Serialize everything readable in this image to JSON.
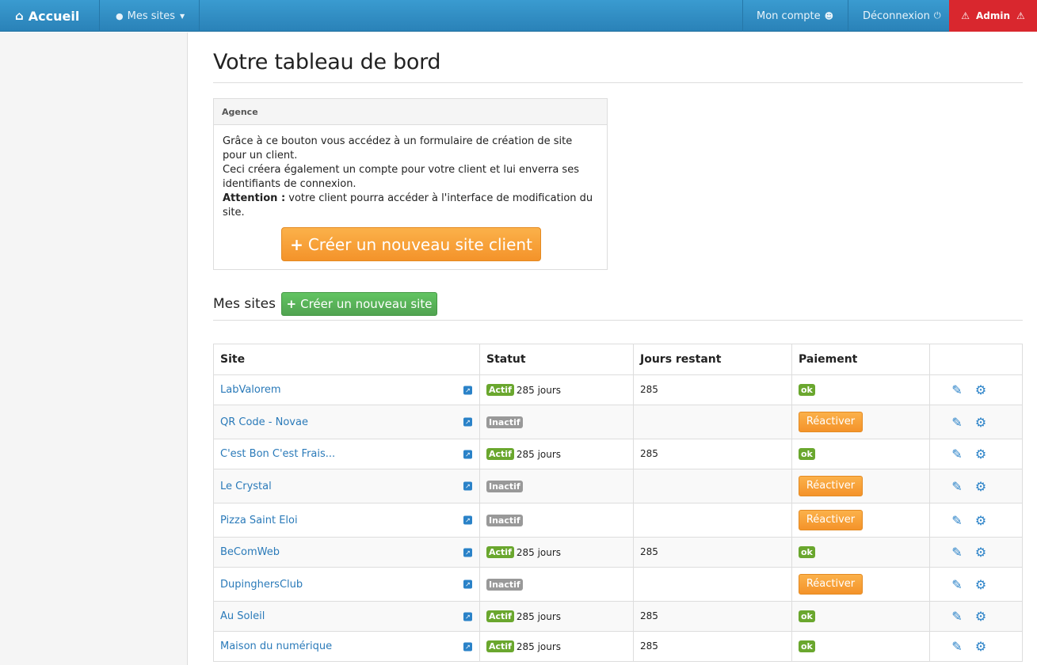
{
  "navbar": {
    "brand": "Accueil",
    "sites_menu": "Mes sites",
    "account": "Mon compte",
    "logout": "Déconnexion",
    "admin": "Admin"
  },
  "page": {
    "title": "Votre tableau de bord"
  },
  "agency_panel": {
    "heading": "Agence",
    "line1": "Grâce à ce bouton vous accédez à un formulaire de création de site pour un client.",
    "line2": "Ceci créera également un compte pour votre client et lui enverra ses identifiants de connexion.",
    "attention_label": "Attention :",
    "attention_text": " votre client pourra accéder à l'interface de modification du site.",
    "button": "Créer un nouveau site client"
  },
  "sites_section": {
    "title": "Mes sites",
    "new_button": "Créer un nouveau site"
  },
  "table": {
    "headers": [
      "Site",
      "Statut",
      "Jours restant",
      "Paiement",
      ""
    ],
    "rows": [
      {
        "site": "LabValorem",
        "status": "Actif",
        "days_text": "285 jours",
        "days": "285",
        "payment": "ok"
      },
      {
        "site": "QR Code - Novae",
        "status": "Inactif",
        "days_text": "",
        "days": "",
        "payment": "Réactiver"
      },
      {
        "site": "C'est Bon C'est Frais...",
        "status": "Actif",
        "days_text": "285 jours",
        "days": "285",
        "payment": "ok"
      },
      {
        "site": "Le Crystal",
        "status": "Inactif",
        "days_text": "",
        "days": "",
        "payment": "Réactiver"
      },
      {
        "site": "Pizza Saint Eloi",
        "status": "Inactif",
        "days_text": "",
        "days": "",
        "payment": "Réactiver"
      },
      {
        "site": "BeComWeb",
        "status": "Actif",
        "days_text": "285 jours",
        "days": "285",
        "payment": "ok"
      },
      {
        "site": "DupinghersClub",
        "status": "Inactif",
        "days_text": "",
        "days": "",
        "payment": "Réactiver"
      },
      {
        "site": "Au Soleil",
        "status": "Actif",
        "days_text": "285 jours",
        "days": "285",
        "payment": "ok"
      },
      {
        "site": "Maison du numérique",
        "status": "Actif",
        "days_text": "285 jours",
        "days": "285",
        "payment": "ok"
      }
    ]
  },
  "colors": {
    "navbar": "#2a82b8",
    "admin": "#d9272e",
    "orange_button": "#f4932a",
    "green_button": "#51a351",
    "active_label": "#6aa72e",
    "inactive_label": "#999999",
    "link": "#2a7ab9"
  },
  "icons": {
    "brand": "home-icon",
    "sites": "globe-icon",
    "account": "user-icon",
    "logout": "power-icon",
    "admin": "warning-icon",
    "external": "external-link-icon",
    "edit": "pencil-icon",
    "settings": "gear-icon"
  }
}
